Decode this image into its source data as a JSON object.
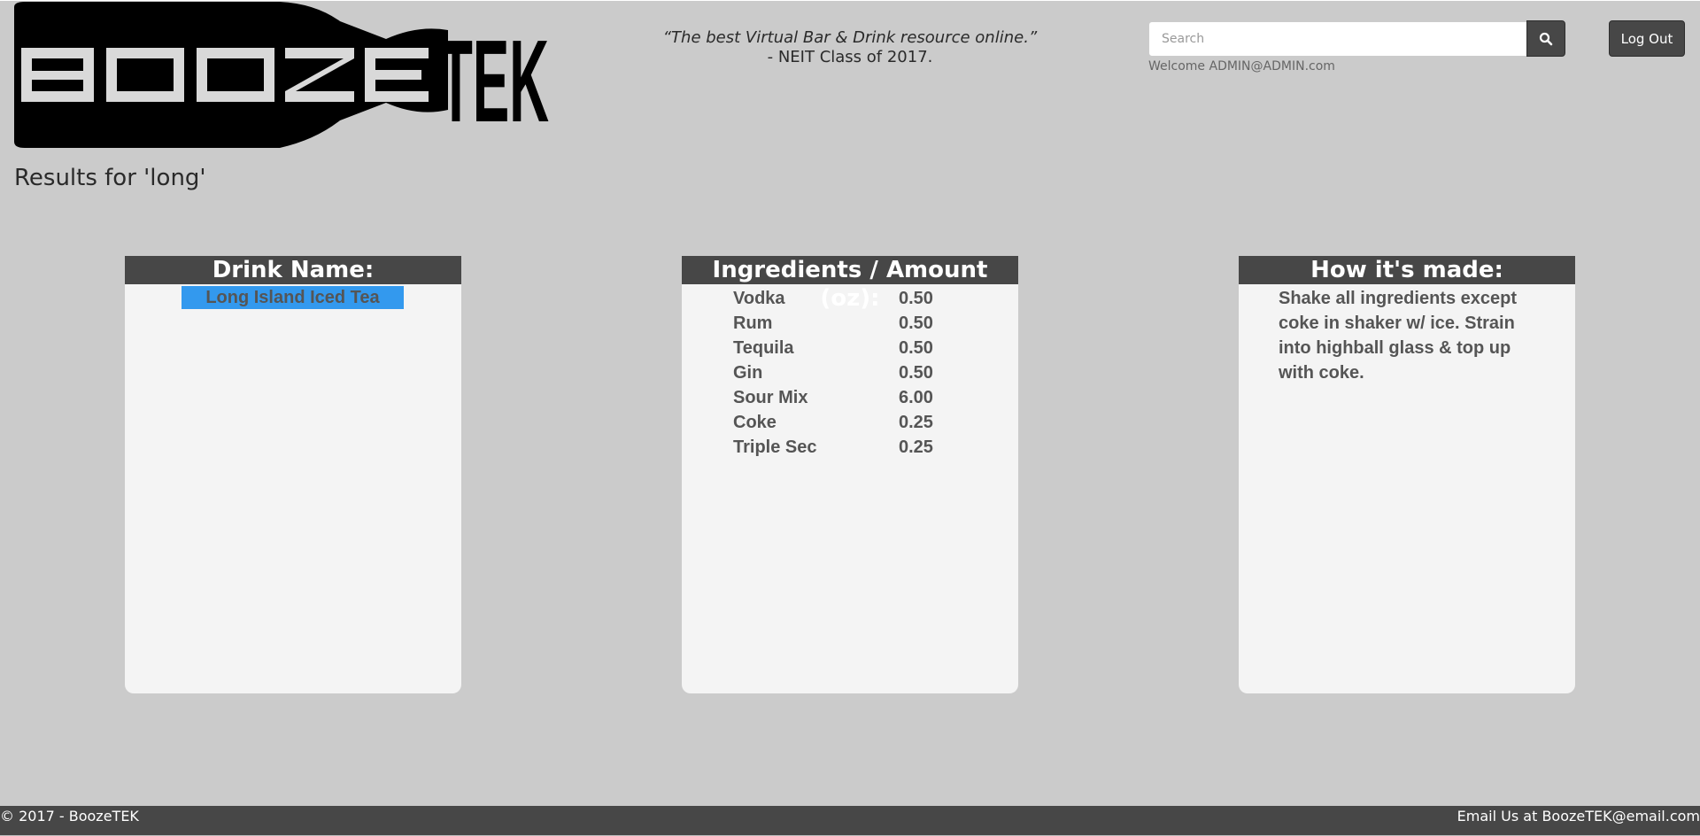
{
  "logo": {
    "part1": "BOOZE",
    "part2": "TEK"
  },
  "header": {
    "tagline_quote": "“The best Virtual Bar & Drink resource online.”",
    "tagline_author": "- NEIT Class of 2017.",
    "search_placeholder": "Search",
    "welcome": "Welcome ADMIN@ADMIN.com",
    "logout_label": "Log Out"
  },
  "results_title": "Results for 'long'",
  "panels": {
    "drink_header": "Drink Name:",
    "ingredients_header": "Ingredients / Amount (oz):",
    "method_header": "How it's made:"
  },
  "drink_name": "Long Island Iced Tea",
  "ingredients": [
    {
      "name": "Vodka",
      "amount": "0.50"
    },
    {
      "name": "Rum",
      "amount": "0.50"
    },
    {
      "name": "Tequila",
      "amount": "0.50"
    },
    {
      "name": "Gin",
      "amount": "0.50"
    },
    {
      "name": "Sour Mix",
      "amount": "6.00"
    },
    {
      "name": "Coke",
      "amount": "0.25"
    },
    {
      "name": "Triple Sec",
      "amount": "0.25"
    }
  ],
  "method": "Shake all ingredients except coke in shaker w/ ice. Strain into highball glass & top up with coke.",
  "footer": {
    "copyright": "© 2017 - BoozeTEK",
    "email": "Email Us at BoozeTEK@email.com"
  },
  "colors": {
    "background": "#cbcbcb",
    "header_bar": "#474747",
    "panel": "#f4f4f4",
    "highlight": "#3399ee"
  },
  "icons": {
    "search": "search-icon"
  }
}
